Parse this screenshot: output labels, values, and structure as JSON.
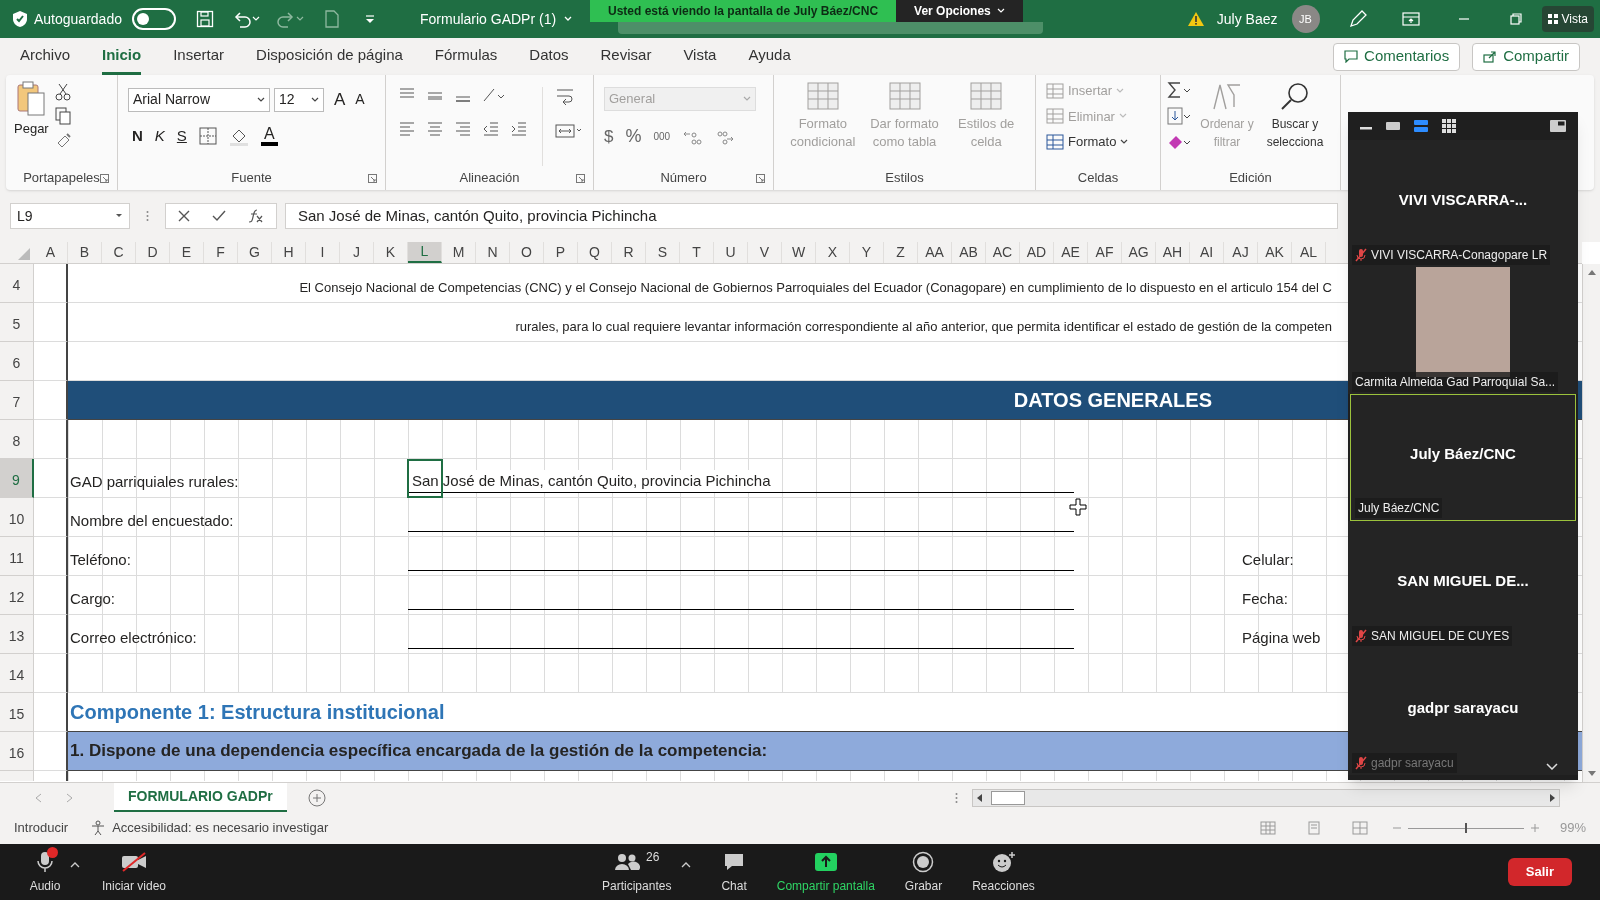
{
  "zoom_banner": {
    "message": "Usted está viendo la pantalla de July Báez/CNC",
    "options_button": "Ver Opciones"
  },
  "title_bar": {
    "autosave_label": "Autoguardado",
    "autosave_on": false,
    "file_name": "Formulario GADPr (1)",
    "user_name": "July Baez",
    "user_initials": "JB",
    "view_button": "Vista"
  },
  "menu_tabs": [
    {
      "label": "Archivo",
      "selected": false
    },
    {
      "label": "Inicio",
      "selected": true
    },
    {
      "label": "Insertar",
      "selected": false
    },
    {
      "label": "Disposición de página",
      "selected": false
    },
    {
      "label": "Fórmulas",
      "selected": false
    },
    {
      "label": "Datos",
      "selected": false
    },
    {
      "label": "Revisar",
      "selected": false
    },
    {
      "label": "Vista",
      "selected": false
    },
    {
      "label": "Ayuda",
      "selected": false
    }
  ],
  "comments_button": "Comentarios",
  "share_button": "Compartir",
  "ribbon": {
    "clipboard": {
      "label": "Portapapeles",
      "paste": "Pegar"
    },
    "font": {
      "label": "Fuente",
      "font_name": "Arial Narrow",
      "font_size": "12",
      "grow": "A",
      "shrink": "A",
      "bold": "N",
      "italic": "K",
      "underline": "S",
      "font_color": "A"
    },
    "alignment": {
      "label": "Alineación"
    },
    "number": {
      "label": "Número",
      "format": "General",
      "format_disabled": true,
      "currency": "$",
      "percent": "%",
      "thousands": "000"
    },
    "styles": {
      "label": "Estilos",
      "items": [
        {
          "label": "Formato condicional",
          "disabled": true
        },
        {
          "label": "Dar formato como tabla",
          "disabled": true
        },
        {
          "label": "Estilos de celda",
          "disabled": true
        }
      ]
    },
    "cells": {
      "label": "Celdas",
      "items": [
        {
          "label": "Insertar",
          "disabled": true
        },
        {
          "label": "Eliminar",
          "disabled": true
        },
        {
          "label": "Formato",
          "disabled": false
        }
      ]
    },
    "editing": {
      "label": "Edición",
      "items": [
        {
          "label": "Ordenar y filtrar",
          "disabled": true
        },
        {
          "label": "Buscar y selecciona",
          "disabled": false
        }
      ]
    }
  },
  "formula_bar": {
    "name_box": "L9",
    "formula": "San José de Minas, cantón Quito, provincia Pichincha"
  },
  "sheet": {
    "columns": [
      {
        "label": "A",
        "selected": false
      },
      {
        "label": "B",
        "selected": false
      },
      {
        "label": "C",
        "selected": false
      },
      {
        "label": "D",
        "selected": false
      },
      {
        "label": "E",
        "selected": false
      },
      {
        "label": "F",
        "selected": false
      },
      {
        "label": "G",
        "selected": false
      },
      {
        "label": "H",
        "selected": false
      },
      {
        "label": "I",
        "selected": false
      },
      {
        "label": "J",
        "selected": false
      },
      {
        "label": "K",
        "selected": false
      },
      {
        "label": "L",
        "selected": true
      },
      {
        "label": "M",
        "selected": false
      },
      {
        "label": "N",
        "selected": false
      },
      {
        "label": "O",
        "selected": false
      },
      {
        "label": "P",
        "selected": false
      },
      {
        "label": "Q",
        "selected": false
      },
      {
        "label": "R",
        "selected": false
      },
      {
        "label": "S",
        "selected": false
      },
      {
        "label": "T",
        "selected": false
      },
      {
        "label": "U",
        "selected": false
      },
      {
        "label": "V",
        "selected": false
      },
      {
        "label": "W",
        "selected": false
      },
      {
        "label": "X",
        "selected": false
      },
      {
        "label": "Y",
        "selected": false
      },
      {
        "label": "Z",
        "selected": false
      },
      {
        "label": "AA",
        "selected": false
      },
      {
        "label": "AB",
        "selected": false
      },
      {
        "label": "AC",
        "selected": false
      },
      {
        "label": "AD",
        "selected": false
      },
      {
        "label": "AE",
        "selected": false
      },
      {
        "label": "AF",
        "selected": false
      },
      {
        "label": "AG",
        "selected": false
      },
      {
        "label": "AH",
        "selected": false
      },
      {
        "label": "AI",
        "selected": false
      },
      {
        "label": "AJ",
        "selected": false
      },
      {
        "label": "AK",
        "selected": false
      },
      {
        "label": "AL",
        "selected": false
      }
    ],
    "rows": [
      {
        "number": "4",
        "selected": false,
        "kind": "intro",
        "text": "El Consejo Nacional de Competencias (CNC) y el Consejo Nacional de Gobiernos Parroquiales del Ecuador (Conagopare) en cumplimiento de lo dispuesto en el articulo 154 del C"
      },
      {
        "number": "5",
        "selected": false,
        "kind": "intro",
        "text": "rurales, para lo cual requiere levantar información correspondiente al año anterior, que permita identificar el estado de gestión de la competen"
      },
      {
        "number": "6",
        "selected": false,
        "kind": "blank"
      },
      {
        "number": "7",
        "selected": false,
        "kind": "banner",
        "text": "DATOS GENERALES"
      },
      {
        "number": "8",
        "selected": false,
        "kind": "grid"
      },
      {
        "number": "9",
        "selected": true,
        "kind": "field",
        "label": "GAD parriquiales rurales:",
        "value": "San José de Minas, cantón Quito, provincia Pichincha"
      },
      {
        "number": "10",
        "selected": false,
        "kind": "field",
        "label": "Nombre del encuestado:"
      },
      {
        "number": "11",
        "selected": false,
        "kind": "field",
        "label": "Teléfono:",
        "side_label": "Celular:"
      },
      {
        "number": "12",
        "selected": false,
        "kind": "field",
        "label": "Cargo:",
        "side_label": "Fecha:"
      },
      {
        "number": "13",
        "selected": false,
        "kind": "field",
        "label": "Correo electrónico:",
        "side_label": "Página web"
      },
      {
        "number": "14",
        "selected": false,
        "kind": "grid"
      },
      {
        "number": "15",
        "selected": false,
        "kind": "heading",
        "text": "Componente 1: Estructura institucional"
      },
      {
        "number": "16",
        "selected": false,
        "kind": "question",
        "text": "1. Dispone de una dependencia específica encargada de la gestión de la competencia:"
      }
    ]
  },
  "sheet_tabs": [
    {
      "label": "FORMULARIO GADPr",
      "selected": true
    }
  ],
  "status_bar": {
    "mode": "Introducir",
    "accessibility": "Accesibilidad: es necesario investigar",
    "zoom": "99%",
    "level": 0.5
  },
  "meeting_panel": {
    "tiles": [
      {
        "kind": "name",
        "display_name": "VIVI VISCARRA-...",
        "label": "VIVI VISCARRA-Conagopare LR",
        "muted": true,
        "active": false
      },
      {
        "kind": "video",
        "label": "Carmita Almeida Gad Parroquial Sa...",
        "muted": false,
        "active": false
      },
      {
        "kind": "name",
        "display_name": "July Báez/CNC",
        "label": "July Báez/CNC",
        "muted": false,
        "active": true
      },
      {
        "kind": "name",
        "display_name": "SAN MIGUEL DE...",
        "label": "SAN MIGUEL DE CUYES",
        "muted": true,
        "active": false
      },
      {
        "kind": "name",
        "display_name": "gadpr sarayacu",
        "label": "gadpr sarayacu",
        "muted": true,
        "active": false
      }
    ]
  },
  "meeting_toolbar": {
    "items": [
      {
        "kind": "audio",
        "label": "Audio",
        "alert": true
      },
      {
        "kind": "video",
        "label": "Iniciar video"
      },
      {
        "kind": "participants",
        "label": "Participantes",
        "count": "26"
      },
      {
        "kind": "chat",
        "label": "Chat"
      },
      {
        "kind": "share",
        "label": "Compartir pantalla"
      },
      {
        "kind": "record",
        "label": "Grabar"
      },
      {
        "kind": "reactions",
        "label": "Reacciones"
      }
    ],
    "leave_button": "Salir"
  }
}
